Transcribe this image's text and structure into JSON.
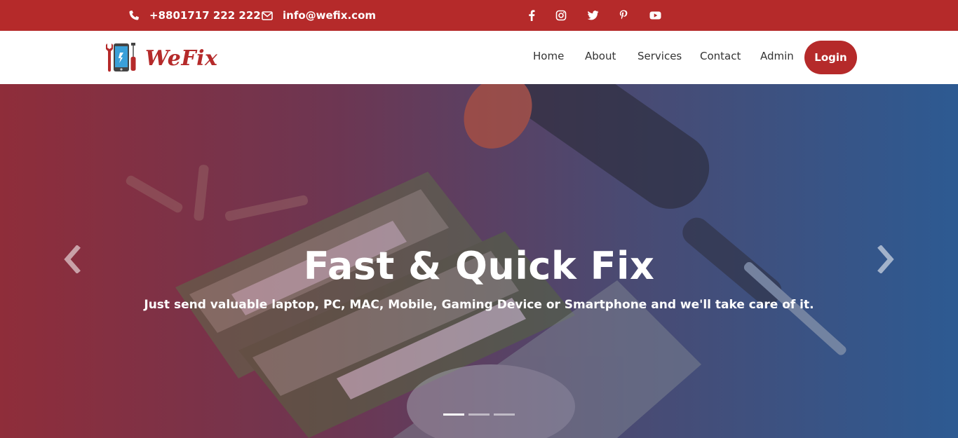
{
  "topbar": {
    "phone": "+8801717 222 222",
    "email": "info@wefix.com",
    "social": [
      "facebook-icon",
      "instagram-icon",
      "twitter-icon",
      "pinterest-icon",
      "youtube-icon"
    ]
  },
  "brand": {
    "name": "WeFix",
    "color": "#b52a2a"
  },
  "nav": {
    "items": [
      {
        "label": "Home"
      },
      {
        "label": "About"
      },
      {
        "label": "Services"
      },
      {
        "label": "Contact"
      },
      {
        "label": "Admin"
      }
    ],
    "login_label": "Login"
  },
  "hero": {
    "title": "Fast & Quick Fix",
    "subtitle": "Just send valuable laptop, PC, MAC, Mobile, Gaming Device or Smartphone and we'll take care of it.",
    "slides": 3,
    "active_slide": 1
  }
}
